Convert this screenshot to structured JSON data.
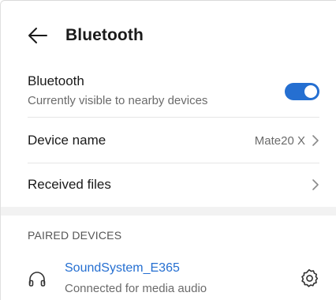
{
  "header": {
    "title": "Bluetooth",
    "back_icon": "arrow-left-icon"
  },
  "bluetooth": {
    "label": "Bluetooth",
    "status": "Currently visible to nearby devices",
    "enabled": true,
    "toggle_color": "#256fd1"
  },
  "device_name": {
    "label": "Device name",
    "value": "Mate20 X"
  },
  "received_files": {
    "label": "Received files"
  },
  "paired_devices": {
    "section_title": "PAIRED DEVICES",
    "items": [
      {
        "name": "SoundSystem_E365",
        "status": "Connected for media audio",
        "icon": "headphones-icon",
        "settings_icon": "gear-icon",
        "name_color": "#256fd1"
      }
    ]
  }
}
